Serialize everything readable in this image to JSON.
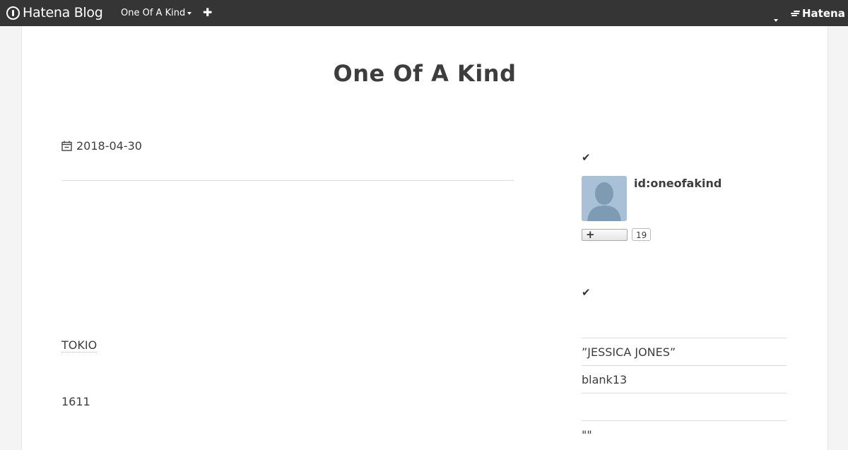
{
  "header": {
    "logo_text": "Hatena Blog",
    "blog_name": "One Of A Kind",
    "add_icon": "plus-icon",
    "hatena_text": "Hatena"
  },
  "blog": {
    "title": "One Of A Kind"
  },
  "entry": {
    "date": "2018-04-30",
    "link_text": "TOKIO",
    "number_text": "1611"
  },
  "sidebar": {
    "profile": {
      "check_icon": "check-icon",
      "id": "id:oneofakind",
      "follow_count": "19"
    },
    "recent": {
      "check_icon": "check-icon",
      "items": [
        {
          "label": "”JESSICA JONES”"
        },
        {
          "label": "blank13"
        },
        {
          "label": ""
        },
        {
          "label": "\"\""
        }
      ]
    }
  }
}
